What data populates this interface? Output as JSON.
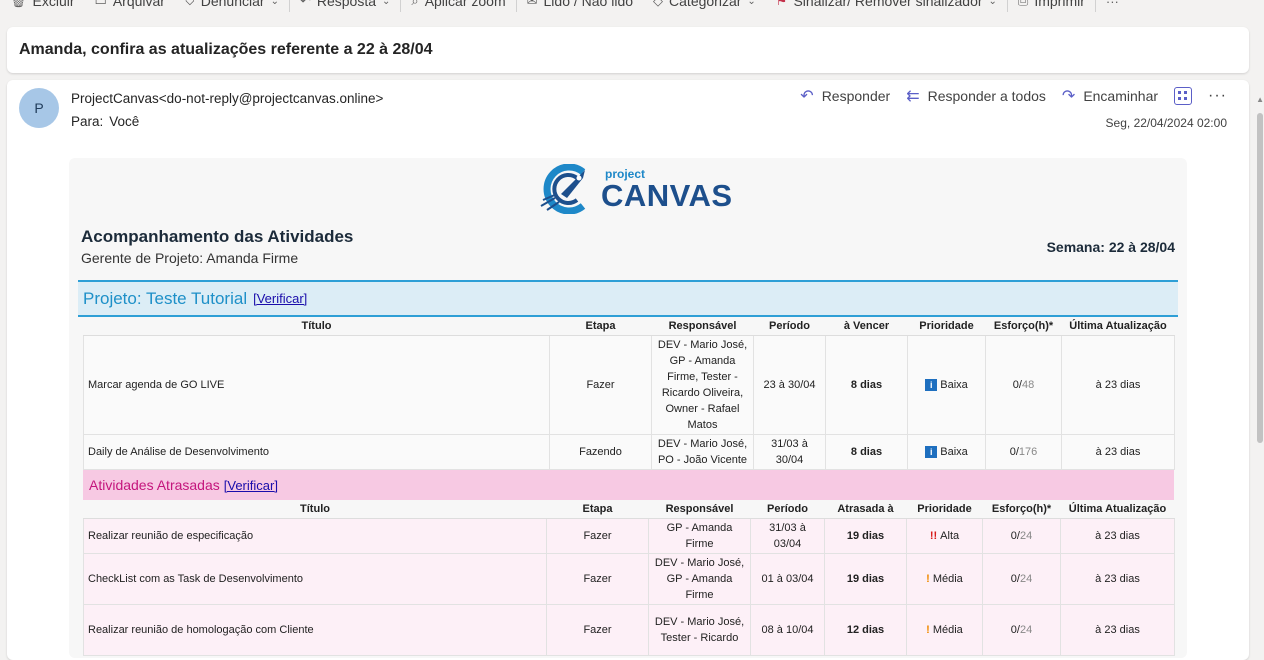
{
  "toolbar": {
    "items": [
      {
        "icon": "trash-icon",
        "glyph": "🗑",
        "label": "Excluir"
      },
      {
        "icon": "archive-icon",
        "glyph": "▭",
        "label": "Arquivar"
      },
      {
        "icon": "report-icon",
        "glyph": "⛉",
        "label": "Denunciar",
        "caret": true
      },
      {
        "icon": "reply-icon",
        "glyph": "↶",
        "label": "Resposta",
        "caret": true
      },
      {
        "icon": "zoom-icon",
        "glyph": "⌕",
        "label": "Aplicar zoom"
      },
      {
        "icon": "envelope-icon",
        "glyph": "✉",
        "label": "Lido / Não lido"
      },
      {
        "icon": "tag-icon",
        "glyph": "◇",
        "label": "Categorizar",
        "caret": true
      },
      {
        "icon": "flag-icon",
        "glyph": "⚑",
        "label": "Sinalizar/ Remover sinalizador",
        "caret": true
      },
      {
        "icon": "print-icon",
        "glyph": "⎙",
        "label": "Imprimir"
      },
      {
        "icon": "more-icon",
        "glyph": "···",
        "label": ""
      }
    ]
  },
  "subject": "Amanda, confira as atualizações referente a 22 à 28/04",
  "message": {
    "avatar_letter": "P",
    "sender": "ProjectCanvas<do-not-reply@projectcanvas.online>",
    "to_label": "Para:",
    "to_value": "Você",
    "date": "Seg, 22/04/2024 02:00",
    "actions": {
      "reply": "Responder",
      "reply_all": "Responder a todos",
      "forward": "Encaminhar",
      "more": "···"
    }
  },
  "body": {
    "logo_small": "project",
    "logo_big": "CANVAS",
    "title": "Acompanhamento das Atividades",
    "subtitle": "Gerente de Projeto: Amanda Firme",
    "week": "Semana: 22 à 28/04",
    "project": {
      "title": "Projeto: Teste Tutorial",
      "link": "[Verificar]",
      "headers": [
        "Título",
        "Etapa",
        "Responsável",
        "Período",
        "à Vencer",
        "Prioridade",
        "Esforço(h)*",
        "Última Atualização"
      ],
      "rows": [
        {
          "titulo": "Marcar agenda de GO LIVE",
          "etapa": "Fazer",
          "responsavel": "DEV - Mario José, GP - Amanda Firme, Tester - Ricardo Oliveira, Owner - Rafael Matos",
          "periodo": "23 à 30/04",
          "vencer": "8 dias",
          "prioridade": "Baixa",
          "prio_level": "low",
          "esforco_a": "0/",
          "esforco_b": "48",
          "atualizacao": "à 23 dias"
        },
        {
          "titulo": "Daily de Análise de Desenvolvimento",
          "etapa": "Fazendo",
          "responsavel": "DEV - Mario José, PO - João Vicente",
          "periodo": "31/03 à 30/04",
          "vencer": "8 dias",
          "prioridade": "Baixa",
          "prio_level": "low",
          "esforco_a": "0/",
          "esforco_b": "176",
          "atualizacao": "à 23 dias"
        }
      ]
    },
    "late": {
      "title": "Atividades Atrasadas",
      "link": "[Verificar]",
      "headers": [
        "Título",
        "Etapa",
        "Responsável",
        "Período",
        "Atrasada à",
        "Prioridade",
        "Esforço(h)*",
        "Última Atualização"
      ],
      "rows": [
        {
          "titulo": "Realizar reunião de especificação",
          "etapa": "Fazer",
          "responsavel": "GP - Amanda Firme",
          "periodo": "31/03 à 03/04",
          "vencer": "19 dias",
          "prioridade": "Alta",
          "prio_level": "high",
          "prio_glyph": "!!",
          "esforco_a": "0/",
          "esforco_b": "24",
          "atualizacao": "à 23 dias"
        },
        {
          "titulo": "CheckList com as Task de Desenvolvimento",
          "etapa": "Fazer",
          "responsavel": "DEV - Mario José, GP - Amanda Firme",
          "periodo": "01 à 03/04",
          "vencer": "19 dias",
          "prioridade": "Média",
          "prio_level": "medium",
          "prio_glyph": "!",
          "esforco_a": "0/",
          "esforco_b": "24",
          "atualizacao": "à 23 dias"
        },
        {
          "titulo": "Realizar reunião de homologação com Cliente",
          "etapa": "Fazer",
          "responsavel": "DEV - Mario José, Tester - Ricardo",
          "periodo": "08 à 10/04",
          "vencer": "12 dias",
          "prioridade": "Média",
          "prio_level": "medium",
          "prio_glyph": "!",
          "esforco_a": "0/",
          "esforco_b": "24",
          "atualizacao": "à 23 dias"
        }
      ]
    }
  }
}
